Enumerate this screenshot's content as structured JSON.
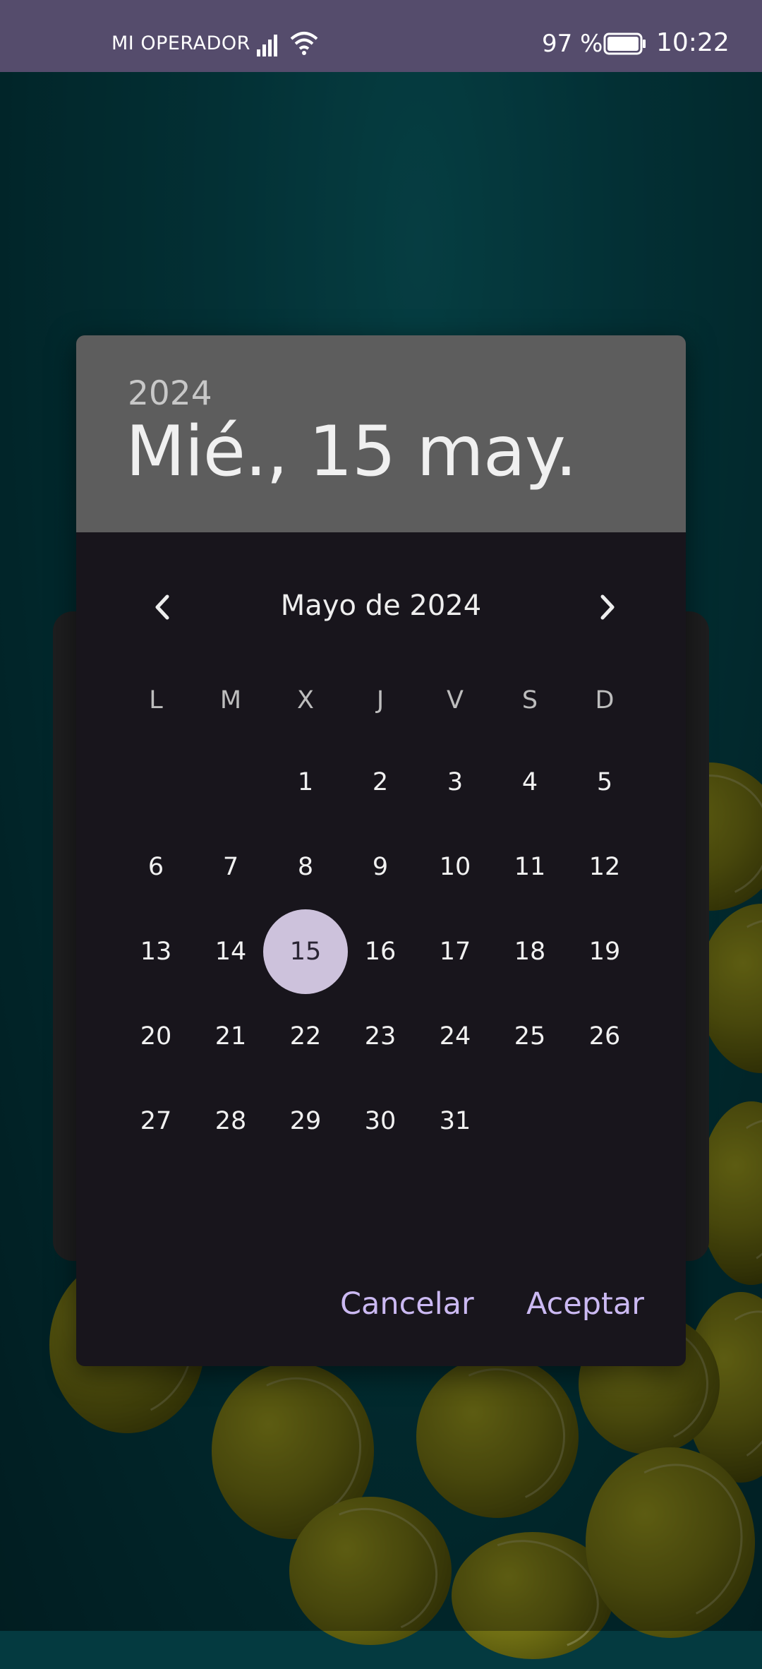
{
  "status_bar": {
    "operator": "MI OPERADOR",
    "battery_percent": "97 %",
    "time": "10:22",
    "icons": [
      "signal-icon",
      "wifi-icon",
      "battery-icon"
    ]
  },
  "date_picker": {
    "header": {
      "year": "2024",
      "selected_date": "Mié., 15 may."
    },
    "month_title": "Mayo de 2024",
    "weekdays": [
      "L",
      "M",
      "X",
      "J",
      "V",
      "S",
      "D"
    ],
    "weeks": [
      [
        "",
        "",
        "1",
        "2",
        "3",
        "4",
        "5"
      ],
      [
        "6",
        "7",
        "8",
        "9",
        "10",
        "11",
        "12"
      ],
      [
        "13",
        "14",
        "15",
        "16",
        "17",
        "18",
        "19"
      ],
      [
        "20",
        "21",
        "22",
        "23",
        "24",
        "25",
        "26"
      ],
      [
        "27",
        "28",
        "29",
        "30",
        "31",
        "",
        ""
      ]
    ],
    "selected_day": "15",
    "buttons": {
      "cancel": "Cancelar",
      "accept": "Aceptar"
    },
    "colors": {
      "accent": "#cbb9f2",
      "selected_circle": "#cdc2dc",
      "header_bg": "#5d5d5d",
      "dialog_bg": "#18151c"
    }
  }
}
